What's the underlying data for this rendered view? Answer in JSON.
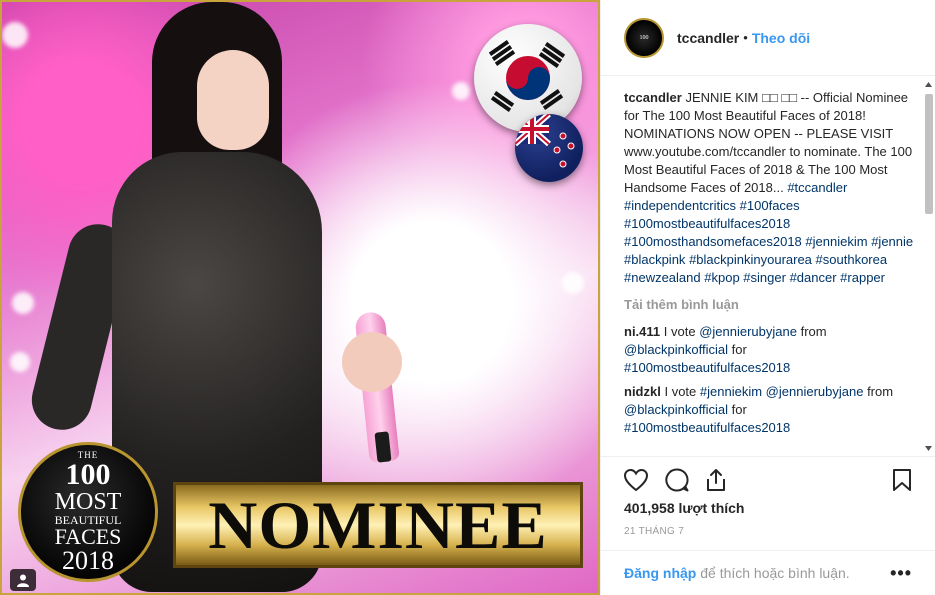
{
  "media": {
    "badge": {
      "the": "THE",
      "number": "100",
      "most": "MOST",
      "beautiful": "BEAUTIFUL",
      "faces": "FACES",
      "year": "2018"
    },
    "nominee": "NOMINEE",
    "flags": [
      "south-korea-flag",
      "new-zealand-flag"
    ]
  },
  "header": {
    "username": "tccandler",
    "separator": "•",
    "follow": "Theo dõi"
  },
  "caption": {
    "username": "tccandler",
    "text_before": "JENNIE KIM □□ □□ -- Official Nominee for The 100 Most Beautiful Faces of 2018! NOMINATIONS NOW OPEN -- PLEASE VISIT www.youtube.com/tccandler to nominate. The 100 Most Beautiful Faces of 2018 & The 100 Most Handsome Faces of 2018...",
    "hashtags": [
      "#tccandler",
      "#independentcritics",
      "#100faces",
      "#100mostbeautifulfaces2018",
      "#100mosthandsomefaces2018",
      "#jenniekim",
      "#jennie",
      "#blackpink",
      "#blackpinkinyourarea",
      "#southkorea",
      "#newzealand",
      "#kpop",
      "#singer",
      "#dancer",
      "#rapper"
    ]
  },
  "load_more": "Tải thêm bình luận",
  "comments": [
    {
      "username": "ni.411",
      "t1": "I vote",
      "m1": "@jennierubyjane",
      "t2": "from",
      "m2": "@blackpinkofficial",
      "t3": "for",
      "h1": "#100mostbeautifulfaces2018"
    },
    {
      "username": "nidzkl",
      "t1": "I vote",
      "h0": "#jenniekim",
      "m1": "@jennierubyjane",
      "t2": "from",
      "m2": "@blackpinkofficial",
      "t3": "for",
      "h1": "#100mostbeautifulfaces2018"
    }
  ],
  "likes": "401,958 lượt thích",
  "date": "21 THÁNG 7",
  "footer": {
    "login": "Đăng nhập",
    "rest": " để thích hoặc bình luận.",
    "more": "•••"
  },
  "colors": {
    "link": "#3897f0",
    "hashtag": "#003569",
    "muted": "#999999",
    "gold": "#c9a43c"
  }
}
